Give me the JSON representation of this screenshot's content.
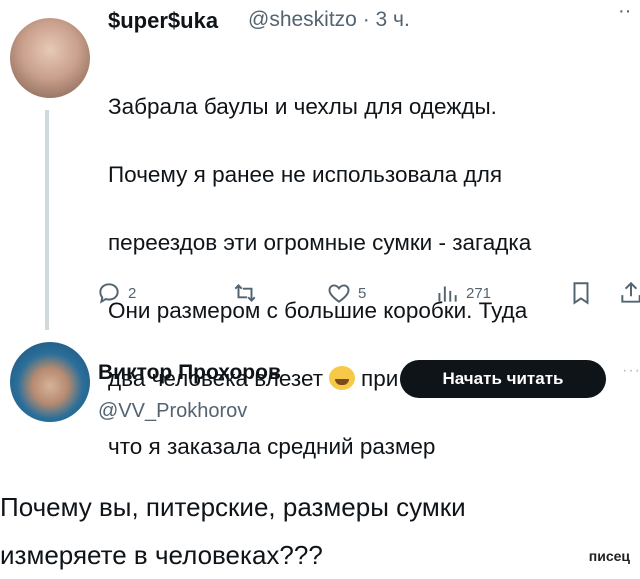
{
  "tweet1": {
    "author_name": "$uper$uka",
    "handle_time": "@sheskitzo · 3 ч.",
    "more": "··",
    "lines_before_emoji": [
      "Забрала баулы и чехлы для одежды.",
      "Почему я ранее не использовала для",
      "переездов эти огромные сумки - загадка",
      "Они размером с большие коробки. Туда"
    ],
    "line5_start": "два человека влезет",
    "line5_end": "при всем том,",
    "line6": "что я заказала средний размер",
    "emoji": "grinning-squinting-face",
    "stats": {
      "replies": "2",
      "retweets": "",
      "likes": "5",
      "views": "271"
    }
  },
  "tweet2": {
    "author_name": "Виктор Прохоров",
    "handle": "@VV_Prokhorov",
    "follow_label": "Начать читать",
    "more": "···",
    "lines": [
      "Почему вы, питерские, размеры сумки",
      "измеряете в человеках???"
    ]
  },
  "watermark": "писец",
  "colors": {
    "text": "#0f1419",
    "muted": "#536471",
    "button_bg": "#0f1419",
    "thread_line": "#cfd9de"
  }
}
